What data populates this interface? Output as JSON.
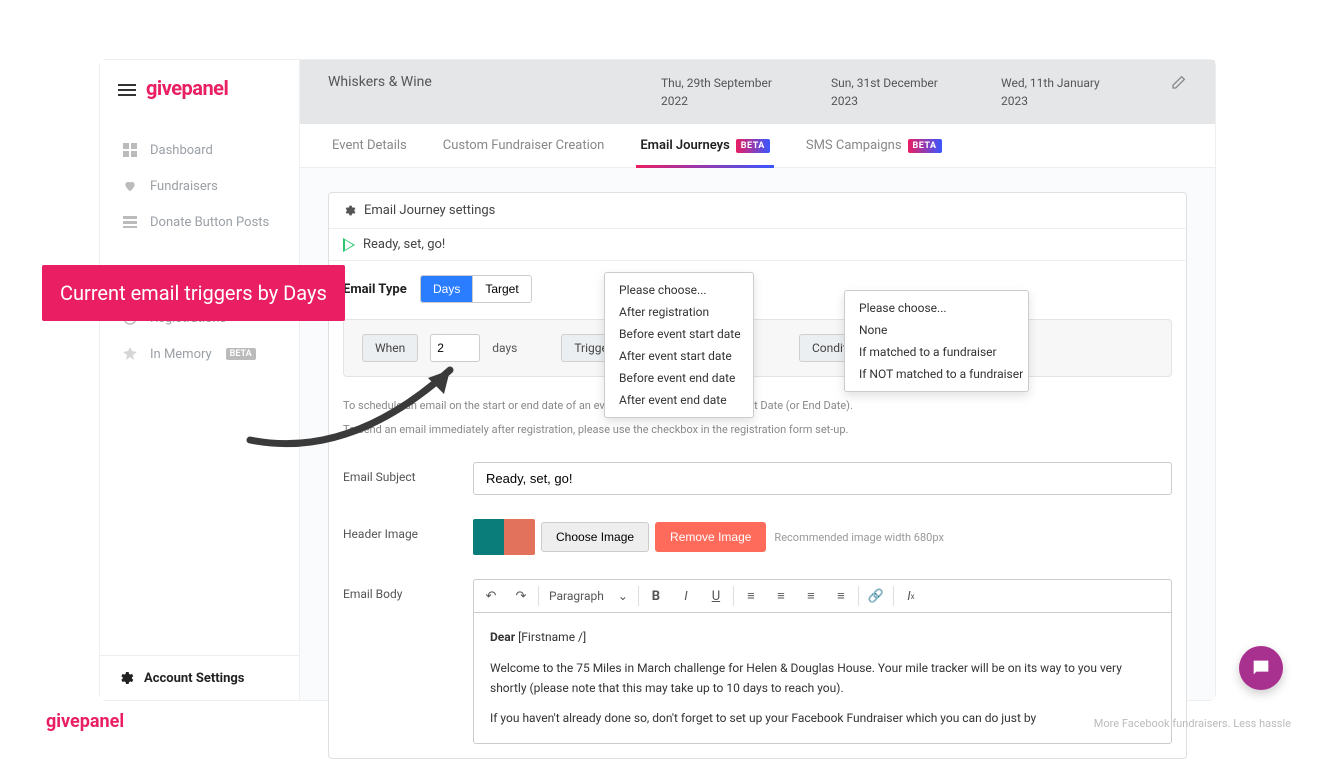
{
  "brand": "givepanel",
  "footer_tag": "More Facebook fundraisers. Less hassle",
  "callout": "Current email triggers by Days",
  "sidebar": {
    "items": [
      {
        "label": "Dashboard",
        "icon": "dashboard"
      },
      {
        "label": "Fundraisers",
        "icon": "heart"
      },
      {
        "label": "Donate Button Posts",
        "icon": "posts"
      },
      {
        "label": "Registrations",
        "icon": "target"
      },
      {
        "label": "In Memory",
        "icon": "memory",
        "badge": "BETA"
      }
    ],
    "settings_label": "Account Settings"
  },
  "header": {
    "org": "Whiskers & Wine",
    "dates": [
      {
        "line1": "Thu, 29th September",
        "line2": "2022"
      },
      {
        "line1": "Sun, 31st December",
        "line2": "2023"
      },
      {
        "line1": "Wed, 11th January",
        "line2": "2023"
      }
    ]
  },
  "tabs": [
    {
      "label": "Event Details"
    },
    {
      "label": "Custom Fundraiser Creation"
    },
    {
      "label": "Email Journeys",
      "badge": "BETA",
      "active": true
    },
    {
      "label": "SMS Campaigns",
      "badge": "BETA"
    }
  ],
  "journey": {
    "settings_title": "Email Journey settings",
    "step_title": "Ready, set, go!",
    "type_label": "Email Type",
    "seg_days": "Days",
    "seg_target": "Target",
    "when_label": "When",
    "when_value": "2",
    "when_unit": "days",
    "trigger_label": "Trigger",
    "condition_label": "Condition",
    "trigger_options": [
      "Please choose...",
      "After registration",
      "Before event start date",
      "After event start date",
      "Before event end date",
      "After event end date"
    ],
    "condition_options": [
      "Please choose...",
      "None",
      "If matched to a fundraiser",
      "If NOT matched to a fundraiser"
    ],
    "note1": "To schedule an email on the start or end date of an event, set 0 days After Event Start Date (or End Date).",
    "note2": "To send an email immediately after registration, please use the checkbox in the registration form set-up.",
    "subject_label": "Email Subject",
    "subject_value": "Ready, set, go!",
    "header_img_label": "Header Image",
    "choose_img": "Choose Image",
    "remove_img": "Remove Image",
    "img_hint": "Recommended image width 680px",
    "body_label": "Email Body",
    "toolbar_para": "Paragraph",
    "body": {
      "greeting_bold": "Dear",
      "greeting_token": "[Firstname /]",
      "p1": "Welcome to the 75 Miles in March challenge for Helen & Douglas House. Your mile tracker will be on its way to you very shortly (please note that this may take up to 10 days to reach you).",
      "p2": "If you haven't already done so, don't forget to set up your Facebook Fundraiser which you can do just by"
    }
  }
}
